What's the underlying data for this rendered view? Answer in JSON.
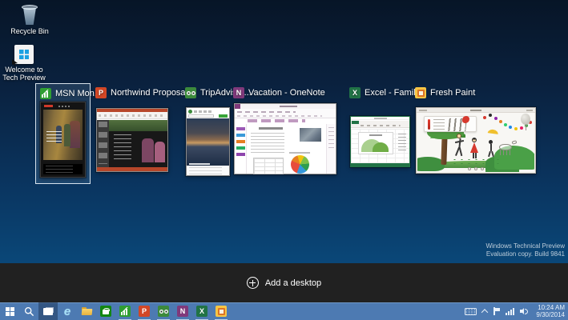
{
  "app": {
    "name": "Windows Technical Preview Task View"
  },
  "colors": {
    "desktop_top": "#071527",
    "desktop_bottom": "#115a90",
    "taskbar": "#4d7ab2",
    "dark_bar": "#212121",
    "selection_border": "#ecf5fc",
    "powerpoint_accent": "#b7472a",
    "onenote_accent": "#80397b",
    "excel_accent": "#217346",
    "msn_green": "#2f9e32",
    "freshpaint_yellow": "#f6c544"
  },
  "desktop": {
    "icons": [
      {
        "label": "Recycle Bin"
      },
      {
        "label": "Welcome to Tech Preview"
      }
    ],
    "watermark": {
      "line1": "Windows Technical Preview",
      "line2": "Evaluation copy. Build 9841"
    }
  },
  "task_view": {
    "windows": [
      {
        "title": "MSN Mon...",
        "app": "MSN Money",
        "selected": true
      },
      {
        "title": "Northwind Proposa...",
        "app": "PowerPoint",
        "selected": false
      },
      {
        "title": "TripAdvisor...",
        "app": "TripAdvisor",
        "selected": false
      },
      {
        "title": "Vacation - OneNote",
        "app": "OneNote",
        "selected": false
      },
      {
        "title": "Excel - Family...",
        "app": "Excel",
        "selected": false
      },
      {
        "title": "Fresh Paint",
        "app": "Fresh Paint",
        "selected": false
      }
    ],
    "add_desktop_label": "Add a desktop"
  },
  "icon_glyphs": {
    "powerpoint": "P",
    "onenote": "N",
    "excel": "X",
    "internet_explorer": "e"
  },
  "taskbar": {
    "buttons": [
      {
        "name": "start"
      },
      {
        "name": "search"
      },
      {
        "name": "task-view",
        "active": true
      },
      {
        "name": "internet-explorer"
      },
      {
        "name": "file-explorer"
      },
      {
        "name": "store"
      },
      {
        "name": "msn-money",
        "running": true
      },
      {
        "name": "powerpoint",
        "running": true
      },
      {
        "name": "tripadvisor",
        "running": true
      },
      {
        "name": "onenote",
        "running": true
      },
      {
        "name": "excel",
        "running": true
      },
      {
        "name": "fresh-paint",
        "running": true
      }
    ],
    "tray": {
      "icons": [
        "touch-keyboard",
        "show-hidden-icons",
        "action-center-flag",
        "network",
        "volume"
      ],
      "time": "10:24 AM",
      "date": "9/30/2014"
    }
  }
}
